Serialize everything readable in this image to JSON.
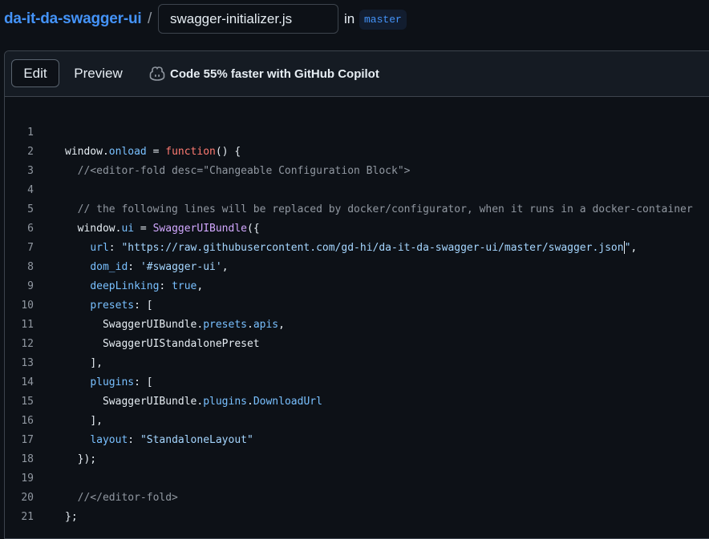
{
  "header": {
    "repo_name": "da-it-da-swagger-ui",
    "separator": "/",
    "filename_value": "swagger-initializer.js",
    "in_label": "in",
    "branch": "master"
  },
  "editor": {
    "tabs": {
      "edit": "Edit",
      "preview": "Preview"
    },
    "copilot_text": "Code 55% faster with GitHub Copilot",
    "line_numbers": [
      "1",
      "2",
      "3",
      "4",
      "5",
      "6",
      "7",
      "8",
      "9",
      "10",
      "11",
      "12",
      "13",
      "14",
      "15",
      "16",
      "17",
      "18",
      "19",
      "20",
      "21"
    ],
    "tokens": {
      "l1": [
        "window",
        ".",
        "onload",
        " = ",
        "function",
        "() {"
      ],
      "l2": [
        "//<editor-fold desc=\"Changeable Configuration Block\">"
      ],
      "l4": [
        "// the following lines will be replaced by docker/configurator, when it runs in a docker-container"
      ],
      "l5": [
        "window",
        ".",
        "ui",
        " = ",
        "SwaggerUIBundle",
        "({"
      ],
      "l6": [
        "url",
        ": ",
        "\"https://raw.githubusercontent.com/gd-hi/da-it-da-swagger-ui/master/swagger.json",
        "\"",
        ","
      ],
      "l7": [
        "dom_id",
        ": ",
        "'#swagger-ui'",
        ","
      ],
      "l8": [
        "deepLinking",
        ": ",
        "true",
        ","
      ],
      "l9": [
        "presets",
        ": ["
      ],
      "l10": [
        "SwaggerUIBundle",
        ".",
        "presets",
        ".",
        "apis",
        ","
      ],
      "l11": [
        "SwaggerUIStandalonePreset"
      ],
      "l12": [
        "],"
      ],
      "l13": [
        "plugins",
        ": ["
      ],
      "l14": [
        "SwaggerUIBundle",
        ".",
        "plugins",
        ".",
        "DownloadUrl"
      ],
      "l15": [
        "],"
      ],
      "l16": [
        "layout",
        ": ",
        "\"StandaloneLayout\""
      ],
      "l17": [
        "});"
      ],
      "l19": [
        "//</editor-fold>"
      ],
      "l20": [
        "};"
      ]
    }
  },
  "colors": {
    "background": "#0d1117",
    "link": "#4493f8",
    "keyword": "#ff7b72",
    "property": "#79c0ff",
    "string": "#a5d6ff",
    "function": "#d2a8ff",
    "comment": "#9198a1"
  },
  "icons": {
    "copilot": "copilot-icon"
  }
}
